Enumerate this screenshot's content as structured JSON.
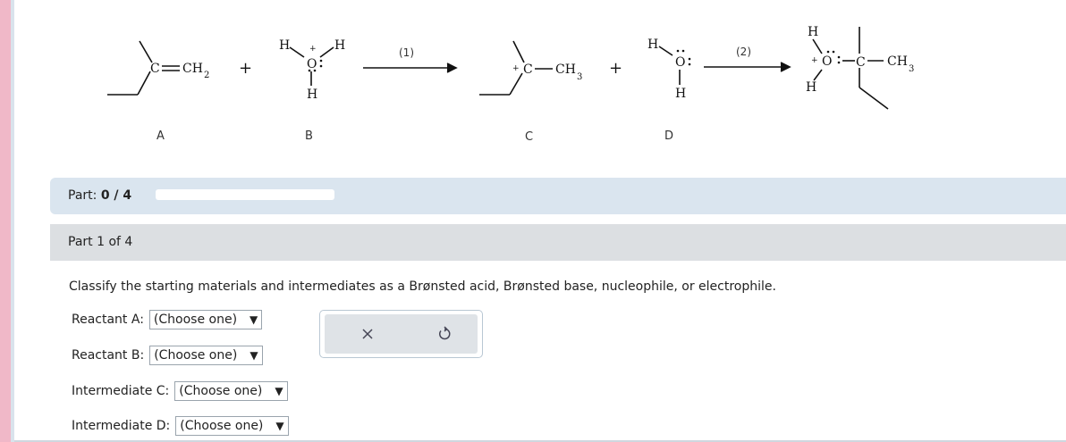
{
  "scheme": {
    "compounds": [
      {
        "label": "A",
        "group": "CH",
        "subscript": "2",
        "atom": "C"
      },
      {
        "label": "B",
        "atom": "O",
        "h_left": "H",
        "h_right": "H",
        "h_bottom": "H",
        "charge": "+"
      },
      {
        "label": "C",
        "atom": "C",
        "group": "CH",
        "subscript": "3",
        "charge": "+"
      },
      {
        "label": "D",
        "atom": "O",
        "h_left": "H",
        "h_bottom": "H"
      }
    ],
    "product": {
      "atom_o": "O",
      "atom_c": "C",
      "group": "CH",
      "subscript": "3",
      "h_top": "H",
      "h_bottom": "H",
      "charge": "+"
    },
    "plus_signs": [
      "+",
      "+"
    ],
    "steps": [
      "(1)",
      "(2)"
    ]
  },
  "progress": {
    "label_prefix": "Part:",
    "value_text": "0 / 4",
    "fraction": 0
  },
  "part_header": "Part 1 of 4",
  "question": "Classify the starting materials and intermediates as a Brønsted acid, Brønsted base, nucleophile, or electrophile.",
  "rows": [
    {
      "label": "Reactant A:",
      "selected": "(Choose one)"
    },
    {
      "label": "Reactant B:",
      "selected": "(Choose one)"
    },
    {
      "label": "Intermediate C:",
      "selected": "(Choose one)"
    },
    {
      "label": "Intermediate D:",
      "selected": "(Choose one)"
    }
  ],
  "select_arrow": "▼",
  "tools": {
    "clear_icon": "close-icon",
    "reset_icon": "undo-icon",
    "accent_color": "#3b7dd8"
  }
}
